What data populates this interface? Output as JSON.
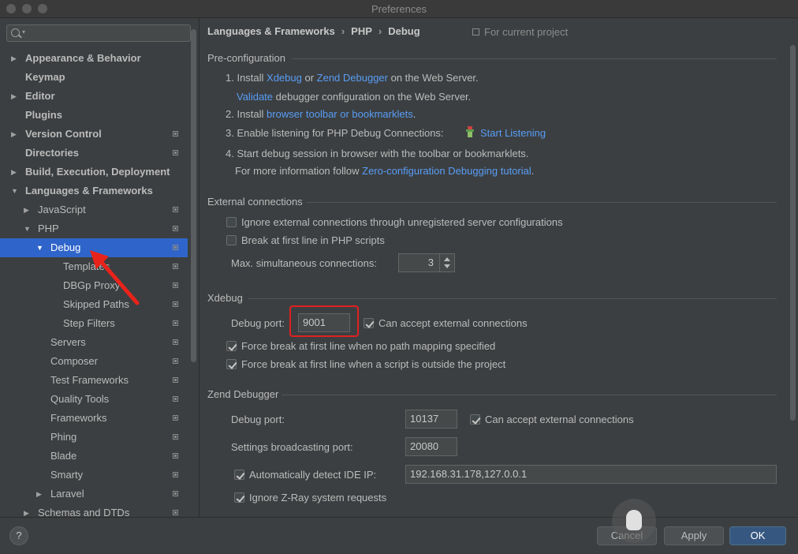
{
  "window": {
    "title": "Preferences"
  },
  "search": {
    "placeholder": ""
  },
  "sidebar": {
    "items": [
      {
        "label": "Appearance & Behavior",
        "expanded": false,
        "has_arrow": true,
        "bold": true,
        "project": false
      },
      {
        "label": "Keymap",
        "has_arrow": false,
        "bold": true,
        "project": false
      },
      {
        "label": "Editor",
        "has_arrow": true,
        "bold": true,
        "project": false
      },
      {
        "label": "Plugins",
        "has_arrow": false,
        "bold": true,
        "project": false
      },
      {
        "label": "Version Control",
        "has_arrow": true,
        "bold": true,
        "project": true
      },
      {
        "label": "Directories",
        "has_arrow": false,
        "bold": true,
        "project": true
      },
      {
        "label": "Build, Execution, Deployment",
        "has_arrow": true,
        "bold": true,
        "project": false
      },
      {
        "label": "Languages & Frameworks",
        "expanded": true,
        "has_arrow": true,
        "bold": true,
        "project": false
      },
      {
        "label": "JavaScript",
        "has_arrow": true,
        "bold": false,
        "project": true
      },
      {
        "label": "PHP",
        "expanded": true,
        "has_arrow": true,
        "bold": false,
        "project": true
      },
      {
        "label": "Debug",
        "expanded": true,
        "has_arrow": true,
        "bold": false,
        "project": true,
        "selected": true
      },
      {
        "label": "Templates",
        "has_arrow": false,
        "bold": false,
        "project": true
      },
      {
        "label": "DBGp Proxy",
        "has_arrow": false,
        "bold": false,
        "project": true
      },
      {
        "label": "Skipped Paths",
        "has_arrow": false,
        "bold": false,
        "project": true
      },
      {
        "label": "Step Filters",
        "has_arrow": false,
        "bold": false,
        "project": true
      },
      {
        "label": "Servers",
        "has_arrow": false,
        "bold": false,
        "project": true
      },
      {
        "label": "Composer",
        "has_arrow": false,
        "bold": false,
        "project": true
      },
      {
        "label": "Test Frameworks",
        "has_arrow": false,
        "bold": false,
        "project": true
      },
      {
        "label": "Quality Tools",
        "has_arrow": false,
        "bold": false,
        "project": true
      },
      {
        "label": "Frameworks",
        "has_arrow": false,
        "bold": false,
        "project": true
      },
      {
        "label": "Phing",
        "has_arrow": false,
        "bold": false,
        "project": true
      },
      {
        "label": "Blade",
        "has_arrow": false,
        "bold": false,
        "project": true
      },
      {
        "label": "Smarty",
        "has_arrow": false,
        "bold": false,
        "project": true
      },
      {
        "label": "Laravel",
        "has_arrow": true,
        "bold": false,
        "project": true
      },
      {
        "label": "Schemas and DTDs",
        "has_arrow": true,
        "bold": false,
        "project": true
      }
    ]
  },
  "breadcrumb": {
    "part1": "Languages & Frameworks",
    "part2": "PHP",
    "part3": "Debug",
    "separator": "›"
  },
  "for_project": "For current project",
  "preconfig": {
    "title": "Pre-configuration",
    "step1_prefix": "1. Install ",
    "step1_link1": "Xdebug",
    "step1_or": " or ",
    "step1_link2": "Zend Debugger",
    "step1_suffix": " on the Web Server.",
    "validate_link": "Validate",
    "validate_suffix": " debugger configuration on the Web Server.",
    "step2_prefix": "2. Install ",
    "step2_link": "browser toolbar or bookmarklets",
    "step2_suffix": ".",
    "step3_prefix": "3. Enable listening for PHP Debug Connections:",
    "step3_link": "Start Listening",
    "step4": "4. Start debug session in browser with the toolbar or bookmarklets.",
    "more_prefix": "For more information follow ",
    "more_link": "Zero-configuration Debugging tutorial",
    "more_suffix": "."
  },
  "external": {
    "title": "External connections",
    "ignore_label": "Ignore external connections through unregistered server configurations",
    "ignore_checked": false,
    "break_label": "Break at first line in PHP scripts",
    "break_checked": false,
    "max_label": "Max. simultaneous connections:",
    "max_value": "3"
  },
  "xdebug": {
    "title": "Xdebug",
    "port_label": "Debug port:",
    "port_value": "9001",
    "accept_label": "Can accept external connections",
    "accept_checked": true,
    "force1_label": "Force break at first line when no path mapping specified",
    "force1_checked": true,
    "force2_label": "Force break at first line when a script is outside the project",
    "force2_checked": true
  },
  "zend": {
    "title": "Zend Debugger",
    "port_label": "Debug port:",
    "port_value": "10137",
    "accept_label": "Can accept external connections",
    "accept_checked": true,
    "broadcast_label": "Settings broadcasting port:",
    "broadcast_value": "20080",
    "detect_label": "Automatically detect IDE IP:",
    "detect_checked": true,
    "ip_value": "192.168.31.178,127.0.0.1",
    "ignore_zray_label": "Ignore Z-Ray system requests",
    "ignore_zray_checked": true
  },
  "footer": {
    "help": "?",
    "cancel": "Cancel",
    "apply": "Apply",
    "ok": "OK"
  },
  "colors": {
    "selection": "#2f65ca",
    "link": "#589df6",
    "highlight_box": "#e02020",
    "annotation_arrow": "#e8231b"
  }
}
